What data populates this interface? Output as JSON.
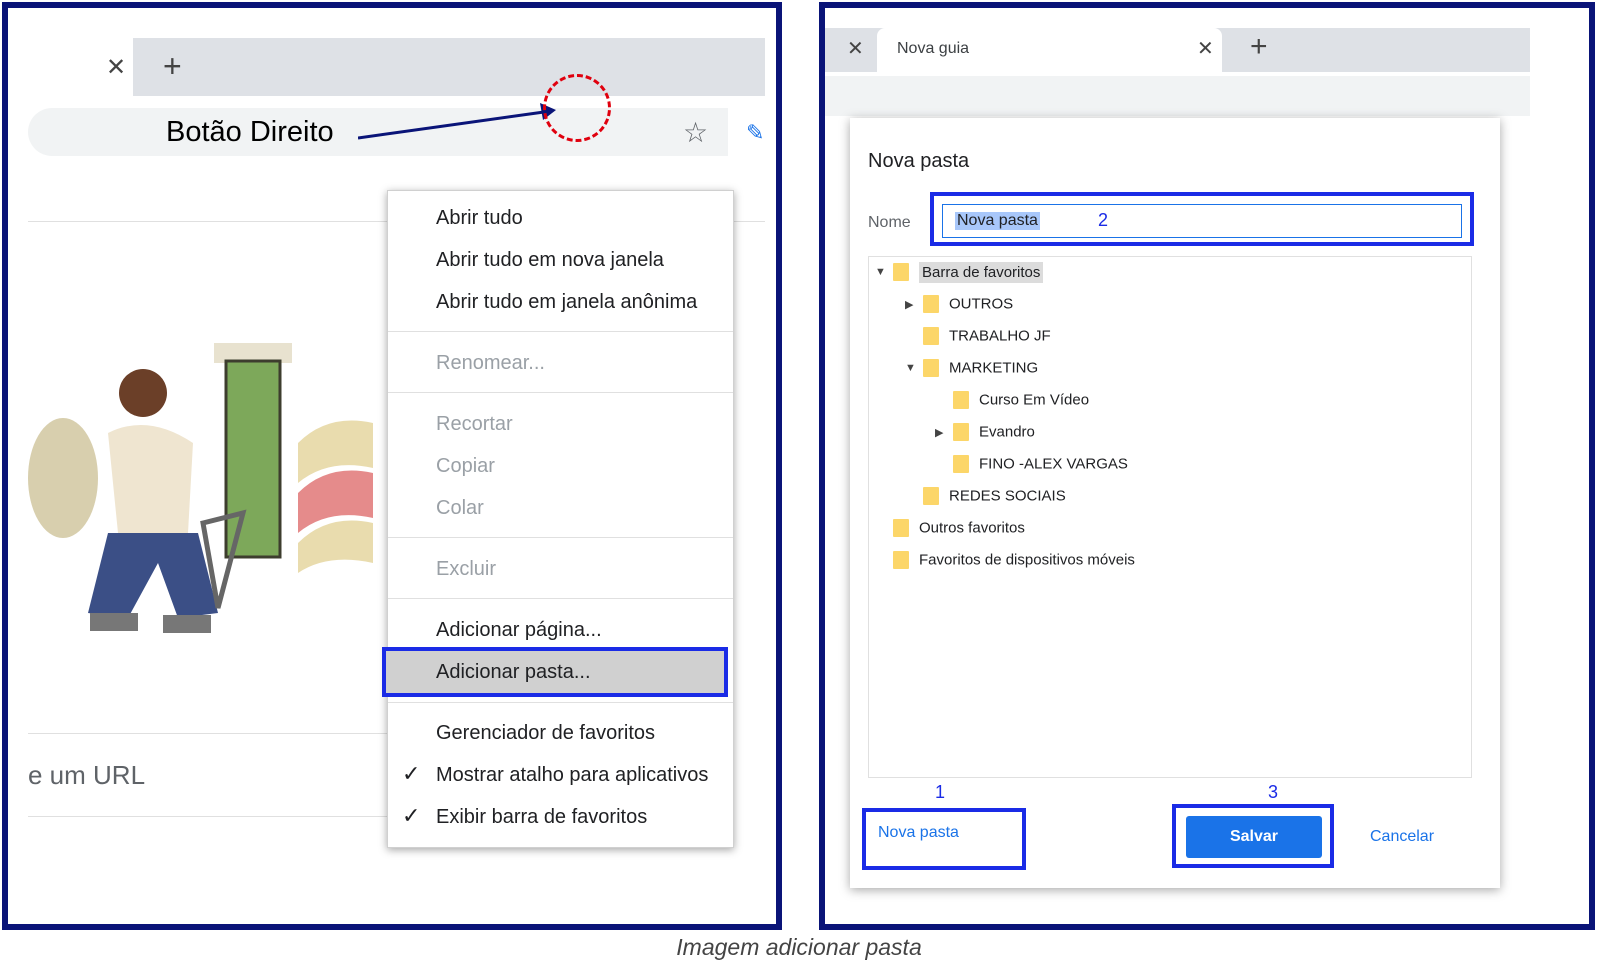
{
  "left": {
    "annotation": "Botão Direito",
    "url_fragment": "e um URL",
    "icons": {
      "close": "close-icon",
      "new_tab": "plus-icon",
      "bookmark": "star-icon"
    },
    "context_menu": {
      "items": [
        "Abrir tudo",
        "Abrir tudo em nova janela",
        "Abrir tudo em janela anônima",
        "Renomear...",
        "Recortar",
        "Copiar",
        "Colar",
        "Excluir",
        "Adicionar página...",
        "Adicionar pasta...",
        "Gerenciador de favoritos",
        "Mostrar atalho para aplicativos",
        "Exibir barra de favoritos"
      ],
      "highlighted": "Adicionar pasta...",
      "checked": [
        "Mostrar atalho para aplicativos",
        "Exibir barra de favoritos"
      ]
    }
  },
  "right": {
    "tab_title": "Nova guia",
    "dialog": {
      "title": "Nova pasta",
      "name_label": "Nome",
      "name_value": "Nova pasta",
      "tree": [
        "Barra de favoritos",
        "OUTROS",
        "TRABALHO JF",
        "MARKETING",
        "Curso Em Vídeo",
        "Evandro",
        "FINO -ALEX VARGAS",
        "REDES SOCIAIS",
        "Outros favoritos",
        "Favoritos de dispositivos móveis"
      ],
      "new_folder_button": "Nova pasta",
      "save_button": "Salvar",
      "cancel_button": "Cancelar"
    },
    "steps": [
      "1",
      "2",
      "3"
    ],
    "highlight_color": "#1a2be6",
    "primary_color": "#1a73e8"
  },
  "caption": "Imagem adicionar pasta"
}
